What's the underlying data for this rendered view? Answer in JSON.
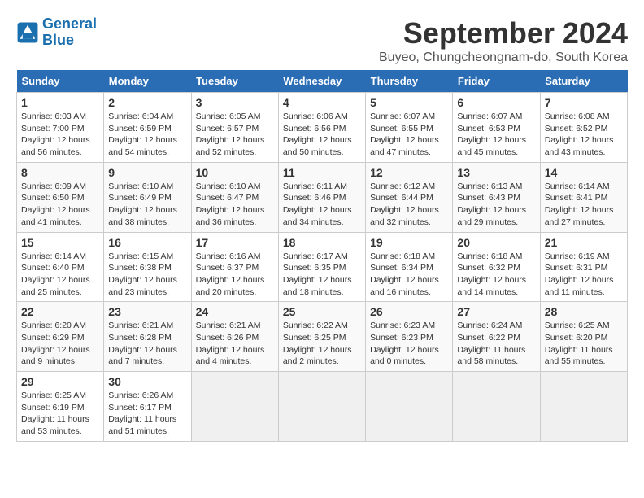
{
  "logo": {
    "line1": "General",
    "line2": "Blue"
  },
  "title": "September 2024",
  "location": "Buyeo, Chungcheongnam-do, South Korea",
  "weekdays": [
    "Sunday",
    "Monday",
    "Tuesday",
    "Wednesday",
    "Thursday",
    "Friday",
    "Saturday"
  ],
  "weeks": [
    [
      {
        "day": "1",
        "sunrise": "6:03 AM",
        "sunset": "7:00 PM",
        "daylight": "12 hours and 56 minutes."
      },
      {
        "day": "2",
        "sunrise": "6:04 AM",
        "sunset": "6:59 PM",
        "daylight": "12 hours and 54 minutes."
      },
      {
        "day": "3",
        "sunrise": "6:05 AM",
        "sunset": "6:57 PM",
        "daylight": "12 hours and 52 minutes."
      },
      {
        "day": "4",
        "sunrise": "6:06 AM",
        "sunset": "6:56 PM",
        "daylight": "12 hours and 50 minutes."
      },
      {
        "day": "5",
        "sunrise": "6:07 AM",
        "sunset": "6:55 PM",
        "daylight": "12 hours and 47 minutes."
      },
      {
        "day": "6",
        "sunrise": "6:07 AM",
        "sunset": "6:53 PM",
        "daylight": "12 hours and 45 minutes."
      },
      {
        "day": "7",
        "sunrise": "6:08 AM",
        "sunset": "6:52 PM",
        "daylight": "12 hours and 43 minutes."
      }
    ],
    [
      {
        "day": "8",
        "sunrise": "6:09 AM",
        "sunset": "6:50 PM",
        "daylight": "12 hours and 41 minutes."
      },
      {
        "day": "9",
        "sunrise": "6:10 AM",
        "sunset": "6:49 PM",
        "daylight": "12 hours and 38 minutes."
      },
      {
        "day": "10",
        "sunrise": "6:10 AM",
        "sunset": "6:47 PM",
        "daylight": "12 hours and 36 minutes."
      },
      {
        "day": "11",
        "sunrise": "6:11 AM",
        "sunset": "6:46 PM",
        "daylight": "12 hours and 34 minutes."
      },
      {
        "day": "12",
        "sunrise": "6:12 AM",
        "sunset": "6:44 PM",
        "daylight": "12 hours and 32 minutes."
      },
      {
        "day": "13",
        "sunrise": "6:13 AM",
        "sunset": "6:43 PM",
        "daylight": "12 hours and 29 minutes."
      },
      {
        "day": "14",
        "sunrise": "6:14 AM",
        "sunset": "6:41 PM",
        "daylight": "12 hours and 27 minutes."
      }
    ],
    [
      {
        "day": "15",
        "sunrise": "6:14 AM",
        "sunset": "6:40 PM",
        "daylight": "12 hours and 25 minutes."
      },
      {
        "day": "16",
        "sunrise": "6:15 AM",
        "sunset": "6:38 PM",
        "daylight": "12 hours and 23 minutes."
      },
      {
        "day": "17",
        "sunrise": "6:16 AM",
        "sunset": "6:37 PM",
        "daylight": "12 hours and 20 minutes."
      },
      {
        "day": "18",
        "sunrise": "6:17 AM",
        "sunset": "6:35 PM",
        "daylight": "12 hours and 18 minutes."
      },
      {
        "day": "19",
        "sunrise": "6:18 AM",
        "sunset": "6:34 PM",
        "daylight": "12 hours and 16 minutes."
      },
      {
        "day": "20",
        "sunrise": "6:18 AM",
        "sunset": "6:32 PM",
        "daylight": "12 hours and 14 minutes."
      },
      {
        "day": "21",
        "sunrise": "6:19 AM",
        "sunset": "6:31 PM",
        "daylight": "12 hours and 11 minutes."
      }
    ],
    [
      {
        "day": "22",
        "sunrise": "6:20 AM",
        "sunset": "6:29 PM",
        "daylight": "12 hours and 9 minutes."
      },
      {
        "day": "23",
        "sunrise": "6:21 AM",
        "sunset": "6:28 PM",
        "daylight": "12 hours and 7 minutes."
      },
      {
        "day": "24",
        "sunrise": "6:21 AM",
        "sunset": "6:26 PM",
        "daylight": "12 hours and 4 minutes."
      },
      {
        "day": "25",
        "sunrise": "6:22 AM",
        "sunset": "6:25 PM",
        "daylight": "12 hours and 2 minutes."
      },
      {
        "day": "26",
        "sunrise": "6:23 AM",
        "sunset": "6:23 PM",
        "daylight": "12 hours and 0 minutes."
      },
      {
        "day": "27",
        "sunrise": "6:24 AM",
        "sunset": "6:22 PM",
        "daylight": "11 hours and 58 minutes."
      },
      {
        "day": "28",
        "sunrise": "6:25 AM",
        "sunset": "6:20 PM",
        "daylight": "11 hours and 55 minutes."
      }
    ],
    [
      {
        "day": "29",
        "sunrise": "6:25 AM",
        "sunset": "6:19 PM",
        "daylight": "11 hours and 53 minutes."
      },
      {
        "day": "30",
        "sunrise": "6:26 AM",
        "sunset": "6:17 PM",
        "daylight": "11 hours and 51 minutes."
      },
      null,
      null,
      null,
      null,
      null
    ]
  ]
}
